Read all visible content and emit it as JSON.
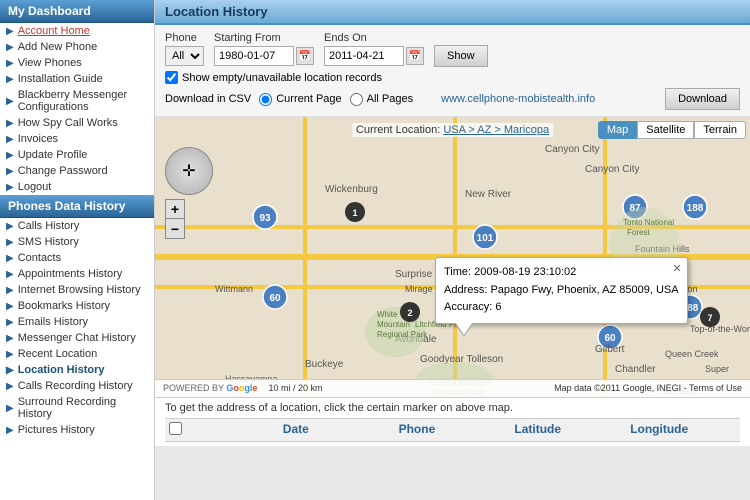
{
  "sidebar": {
    "section1": "My Dashboard",
    "section2": "Phones Data History",
    "items_top": [
      {
        "label": "Account Home",
        "href": true
      },
      {
        "label": "Add New Phone",
        "href": false
      },
      {
        "label": "View Phones",
        "href": false
      },
      {
        "label": "Installation Guide",
        "href": false
      },
      {
        "label": "Blackberry Messenger Configurations",
        "href": false
      },
      {
        "label": "How Spy Call Works",
        "href": false
      },
      {
        "label": "Invoices",
        "href": false
      },
      {
        "label": "Update Profile",
        "href": false
      },
      {
        "label": "Change Password",
        "href": false
      },
      {
        "label": "Logout",
        "href": false
      }
    ],
    "items_bottom": [
      {
        "label": "Calls History"
      },
      {
        "label": "SMS History"
      },
      {
        "label": "Contacts"
      },
      {
        "label": "Appointments History"
      },
      {
        "label": "Internet Browsing History"
      },
      {
        "label": "Bookmarks History"
      },
      {
        "label": "Emails History"
      },
      {
        "label": "Messenger Chat History"
      },
      {
        "label": "Recent Location"
      },
      {
        "label": "Location History",
        "active": true
      },
      {
        "label": "Calls Recording History"
      },
      {
        "label": "Surround Recording History"
      },
      {
        "label": "Pictures History"
      }
    ]
  },
  "main": {
    "title": "Location History",
    "controls": {
      "phone_label": "Phone",
      "phone_value": "All",
      "starting_from_label": "Starting From",
      "starting_from_value": "1980-01-07",
      "ends_on_label": "Ends On",
      "ends_on_value": "2011-04-21",
      "show_button": "Show",
      "checkbox_label": "Show empty/unavailable location records",
      "download_csv_label": "Download in CSV",
      "current_page_label": "Current Page",
      "all_pages_label": "All Pages",
      "website": "www.cellphone-mobistealth.info",
      "download_button": "Download"
    },
    "map": {
      "tabs": [
        "Map",
        "Satellite",
        "Terrain"
      ],
      "active_tab": "Map",
      "breadcrumb": "Current Location: USA > AZ > Maricopa",
      "popup": {
        "time": "Time: 2009-08-19 23:10:02",
        "address": "Address: Papago Fwy, Phoenix, AZ 85009, USA",
        "accuracy": "Accuracy: 6"
      },
      "bottom_text": "Map data ©2011 Google, INEGI - Terms of Use",
      "powered_by": "POWERED BY Google",
      "scale": "10 mi / 20 km"
    },
    "table": {
      "note": "To get the address of a location, click the certain marker on above map.",
      "columns": [
        "",
        "Date",
        "Phone",
        "Latitude",
        "Longitude"
      ]
    }
  }
}
